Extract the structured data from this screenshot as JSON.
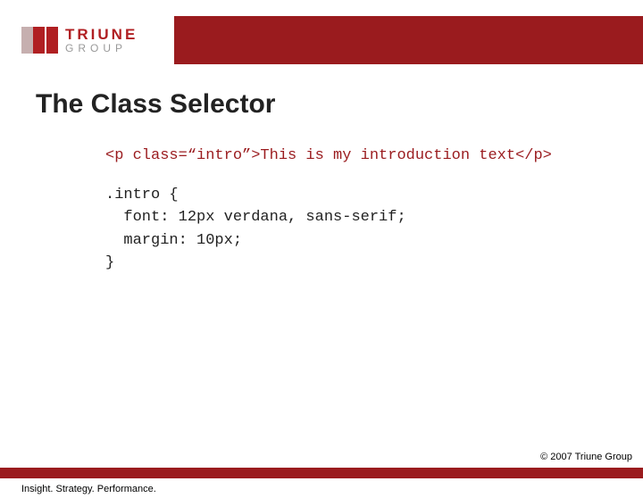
{
  "brand": {
    "title": "TRIUNE",
    "subtitle": "GROUP"
  },
  "slide": {
    "title": "The Class Selector",
    "code_html": "<p class=“intro”>This is my introduction text</p>",
    "code_css": ".intro {\n  font: 12px verdana, sans-serif;\n  margin: 10px;\n}"
  },
  "footer": {
    "copyright": "© 2007 Triune Group",
    "tagline": "Insight. Strategy. Performance."
  }
}
